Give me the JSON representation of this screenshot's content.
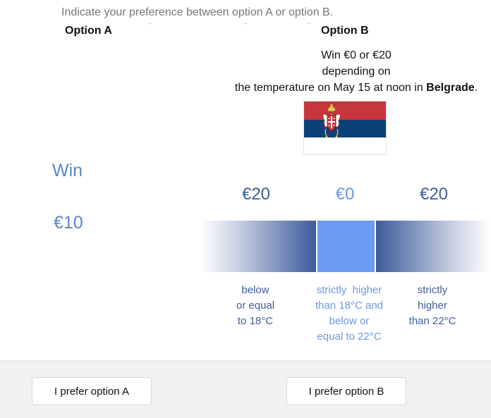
{
  "instruction": "Indicate your preference between option A or option B.",
  "option_a": {
    "heading": "Option A",
    "win_label": "Win",
    "amount": "€10"
  },
  "option_b": {
    "heading": "Option B",
    "desc_line1": "Win €0 or €20",
    "desc_line2": "depending on",
    "desc_line3_prefix": "the temperature on May 15 at noon in ",
    "city": "Belgrade",
    "desc_line3_suffix": ".",
    "flag_icon": "serbia-flag-icon",
    "flag_colors": [
      "#c6363c",
      "#0c4076",
      "#ffffff"
    ],
    "outcomes": [
      {
        "amount": "€20",
        "cond_line1": "below",
        "cond_line2": "or equal",
        "cond_line3": "to 18°C",
        "color": "#3d5d9b"
      },
      {
        "amount": "€0",
        "cond_line1": "strictly  higher",
        "cond_line2": "than 18°C and",
        "cond_line3": "below or",
        "cond_line4": "equal to 22°C",
        "color": "#6a97e6"
      },
      {
        "amount": "€20",
        "cond_line1": "strictly",
        "cond_line2": "higher",
        "cond_line3": "than 22°C",
        "color": "#3d5d9b"
      }
    ]
  },
  "buttons": {
    "prefer_a": "I prefer option A",
    "prefer_b": "I prefer option B"
  }
}
